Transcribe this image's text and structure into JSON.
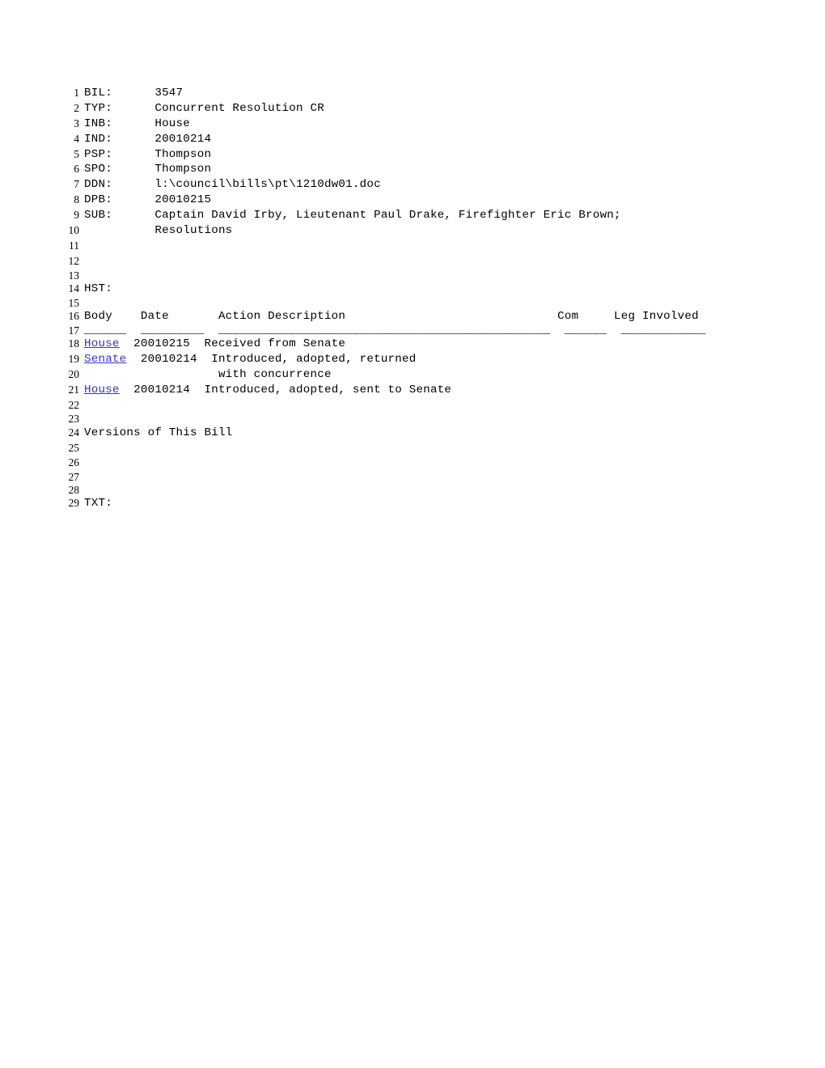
{
  "document": {
    "kind": "legislative-bill-listing",
    "bill_number": "3547",
    "link_color": "#3333CC",
    "text_color": "#000000",
    "background_color": "#FFFFFF"
  },
  "fields": [
    {
      "line": "1",
      "label": "BIL:",
      "value": "3547"
    },
    {
      "line": "2",
      "label": "TYP:",
      "value": "Concurrent Resolution CR"
    },
    {
      "line": "3",
      "label": "INB:",
      "value": "House"
    },
    {
      "line": "4",
      "label": "IND:",
      "value": "20010214"
    },
    {
      "line": "5",
      "label": "PSP:",
      "value": "Thompson"
    },
    {
      "line": "6",
      "label": "SPO:",
      "value": "Thompson"
    },
    {
      "line": "7",
      "label": "DDN:",
      "value": "l:\\council\\bills\\pt\\1210dw01.doc"
    },
    {
      "line": "8",
      "label": "DPB:",
      "value": "20010215"
    },
    {
      "line": "9",
      "label": "SUB:",
      "value": "Captain David Irby, Lieutenant Paul Drake, Firefighter Eric Brown;"
    },
    {
      "line": "10",
      "label": "",
      "value": "Resolutions"
    }
  ],
  "lines": {
    "l1": "BIL:      3547",
    "l2": "TYP:      Concurrent Resolution CR",
    "l3": "INB:      House",
    "l4": "IND:      20010214",
    "l5": "PSP:      Thompson",
    "l6": "SPO:      Thompson",
    "l7": "DDN:      l:\\council\\bills\\pt\\1210dw01.doc",
    "l8": "DPB:      20010215",
    "l9": "SUB:      Captain David Irby, Lieutenant Paul Drake, Firefighter Eric Brown;",
    "l10": "          Resolutions",
    "l11": "",
    "l12": "",
    "l13": "",
    "l14": "HST:",
    "l15": "",
    "l16": "Body    Date       Action Description                              Com     Leg Involved",
    "l17": "______  _________  _______________________________________________  ______  ____________",
    "l18_date_desc": "  20010215  Received from Senate",
    "l19_date_desc": "  20010214  Introduced, adopted, returned",
    "l20": "                   with concurrence",
    "l21_date_desc": "  20010214  Introduced, adopted, sent to Senate",
    "l22": "",
    "l23": "",
    "l24": "Versions of This Bill",
    "l25": "",
    "l26": "",
    "l27": "",
    "l28": "",
    "l29": "TXT:"
  },
  "history": {
    "section_label": "HST:",
    "columns": [
      "Body",
      "Date",
      "Action Description",
      "Com",
      "Leg Involved"
    ],
    "column_rules": [
      "______",
      "_________",
      "_______________________________________________",
      "______",
      "____________"
    ],
    "rows": [
      {
        "line": "18",
        "body": "House",
        "body_is_link": true,
        "date": "20010215",
        "action": "Received from Senate",
        "com": "",
        "leg_involved": ""
      },
      {
        "line": "19",
        "body": "Senate",
        "body_is_link": true,
        "date": "20010214",
        "action": "Introduced, adopted, returned",
        "com": "",
        "leg_involved": ""
      },
      {
        "line": "20",
        "body": "",
        "body_is_link": false,
        "date": "",
        "action": "with concurrence",
        "com": "",
        "leg_involved": ""
      },
      {
        "line": "21",
        "body": "House",
        "body_is_link": true,
        "date": "20010214",
        "action": "Introduced, adopted, sent to Senate",
        "com": "",
        "leg_involved": ""
      }
    ]
  },
  "sections": {
    "versions_heading": "Versions of This Bill",
    "text_label": "TXT:"
  },
  "line_numbers": [
    "1",
    "2",
    "3",
    "4",
    "5",
    "6",
    "7",
    "8",
    "9",
    "10",
    "11",
    "12",
    "13",
    "14",
    "15",
    "16",
    "17",
    "18",
    "19",
    "20",
    "21",
    "22",
    "23",
    "24",
    "25",
    "26",
    "27",
    "28",
    "29"
  ]
}
